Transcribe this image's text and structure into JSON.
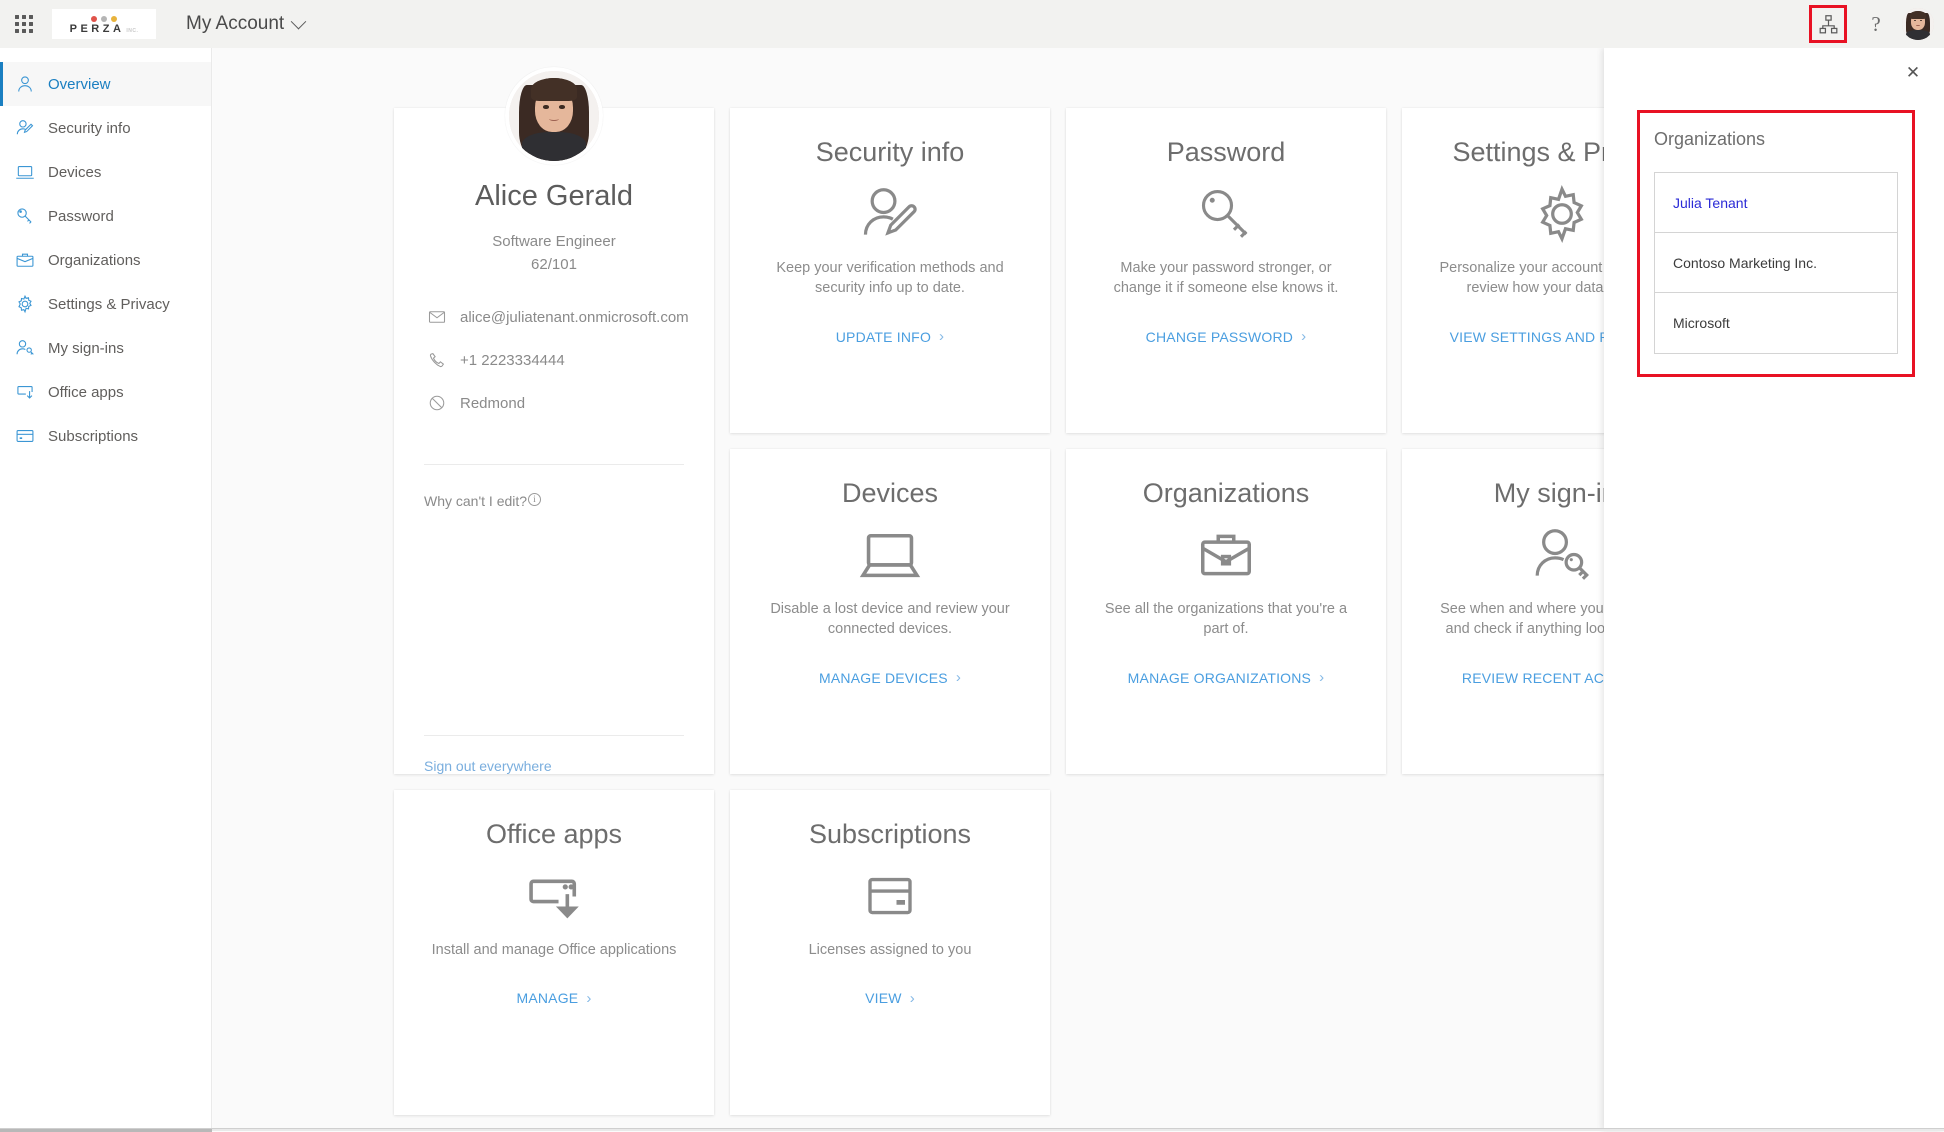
{
  "header": {
    "waffle_label": "app-launcher",
    "logo": {
      "word": "PERZA",
      "suffix": "INC.",
      "dot_colors": [
        "#e0534a",
        "#b5b5b5",
        "#e8b33c"
      ]
    },
    "app_title": "My Account",
    "org_switcher_icon": "org-hierarchy-icon",
    "help_glyph": "?",
    "highlight_color": "#e81123"
  },
  "sidebar": {
    "items": [
      {
        "label": "Overview",
        "icon": "person-icon",
        "active": true
      },
      {
        "label": "Security info",
        "icon": "person-pencil-icon",
        "active": false
      },
      {
        "label": "Devices",
        "icon": "laptop-icon",
        "active": false
      },
      {
        "label": "Password",
        "icon": "key-icon",
        "active": false
      },
      {
        "label": "Organizations",
        "icon": "briefcase-icon",
        "active": false
      },
      {
        "label": "Settings & Privacy",
        "icon": "gear-icon",
        "active": false
      },
      {
        "label": "My sign-ins",
        "icon": "person-key-icon",
        "active": false
      },
      {
        "label": "Office apps",
        "icon": "office-download-icon",
        "active": false
      },
      {
        "label": "Subscriptions",
        "icon": "card-icon",
        "active": false
      }
    ]
  },
  "profile": {
    "name": "Alice Gerald",
    "role": "Software Engineer",
    "employee_id": "62/101",
    "email": "alice@juliatenant.onmicrosoft.com",
    "phone": "+1 2223334444",
    "location": "Redmond",
    "why_cant_edit": "Why can't I edit?",
    "sign_out_everywhere": "Sign out everywhere"
  },
  "cards": [
    {
      "title": "Security info",
      "icon": "person-pencil-icon",
      "desc": "Keep your verification methods and security info up to date.",
      "link": "UPDATE INFO"
    },
    {
      "title": "Password",
      "icon": "key-icon",
      "desc": "Make your password stronger, or change it if someone else knows it.",
      "link": "CHANGE PASSWORD"
    },
    {
      "title": "Settings & Privacy",
      "icon": "gear-icon",
      "desc": "Personalize your account settings and review how your data is used.",
      "link": "VIEW SETTINGS AND PRIVACY"
    },
    {
      "title": "Devices",
      "icon": "laptop-icon",
      "desc": "Disable a lost device and review your connected devices.",
      "link": "MANAGE DEVICES"
    },
    {
      "title": "Organizations",
      "icon": "briefcase-icon",
      "desc": "See all the organizations that you're a part of.",
      "link": "MANAGE ORGANIZATIONS"
    },
    {
      "title": "My sign-ins",
      "icon": "person-key-icon",
      "desc": "See when and where you've signed in and check if anything looks unusual.",
      "link": "REVIEW RECENT ACTIVITY"
    },
    {
      "title": "Office apps",
      "icon": "office-download-icon",
      "desc": "Install and manage Office applications",
      "link": "MANAGE"
    },
    {
      "title": "Subscriptions",
      "icon": "card-icon",
      "desc": "Licenses assigned to you",
      "link": "VIEW"
    }
  ],
  "organizations_panel": {
    "title": "Organizations",
    "close_glyph": "✕",
    "items": [
      {
        "name": "Julia Tenant",
        "current": true
      },
      {
        "name": "Contoso Marketing Inc.",
        "current": false
      },
      {
        "name": "Microsoft",
        "current": false
      }
    ]
  }
}
